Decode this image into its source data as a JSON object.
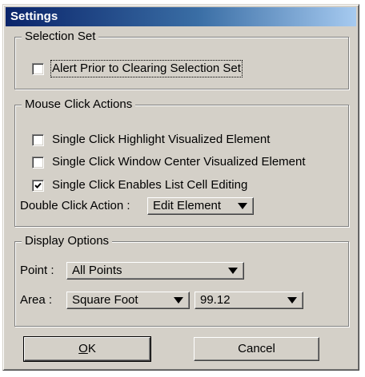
{
  "dialog": {
    "title": "Settings"
  },
  "selection_set": {
    "legend": "Selection Set",
    "alert_checkbox": {
      "label": "Alert Prior to Clearing Selection Set",
      "checked": false
    }
  },
  "mouse_click_actions": {
    "legend": "Mouse Click Actions",
    "checkboxes": [
      {
        "label": "Single Click Highlight Visualized Element",
        "checked": false
      },
      {
        "label": "Single Click Window Center Visualized Element",
        "checked": false
      },
      {
        "label": "Single Click Enables List Cell Editing",
        "checked": true
      }
    ],
    "double_click_label": "Double Click Action :",
    "double_click_value": "Edit Element"
  },
  "display_options": {
    "legend": "Display Options",
    "point_label": "Point :",
    "point_value": "All Points",
    "area_label": "Area :",
    "area_unit_value": "Square Foot",
    "area_number_value": "99.12"
  },
  "buttons": {
    "ok_accel": "O",
    "ok_rest": "K",
    "cancel_label": "Cancel"
  },
  "colors": {
    "titlebar_start": "#0a246a",
    "titlebar_end": "#a6caf0",
    "dialog_face": "#d4d0c8"
  },
  "icons": {
    "checkmark": "checkmark-icon",
    "dropdown": "dropdown-arrow-icon"
  }
}
